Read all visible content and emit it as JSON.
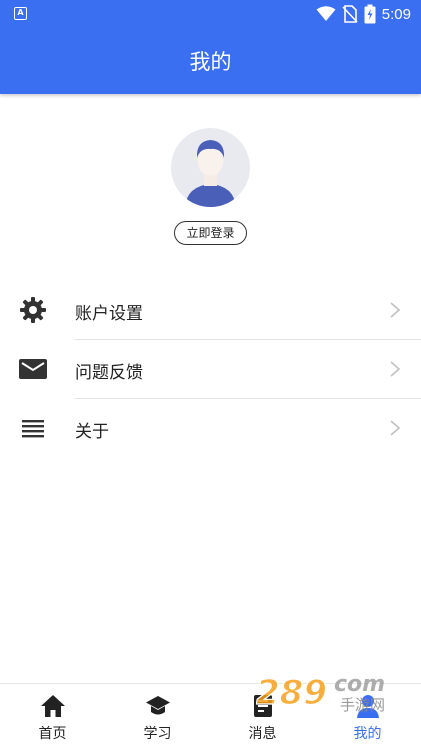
{
  "status_bar": {
    "time": "5:09",
    "app_icon": "A"
  },
  "header": {
    "title": "我的"
  },
  "profile": {
    "login_label": "立即登录"
  },
  "menu": [
    {
      "label": "账户设置",
      "icon": "gear-icon"
    },
    {
      "label": "问题反馈",
      "icon": "mail-icon"
    },
    {
      "label": "关于",
      "icon": "list-icon"
    }
  ],
  "tabs": [
    {
      "label": "首页",
      "icon": "home-icon",
      "active": false
    },
    {
      "label": "学习",
      "icon": "graduation-cap-icon",
      "active": false
    },
    {
      "label": "消息",
      "icon": "document-icon",
      "active": false
    },
    {
      "label": "我的",
      "icon": "user-icon",
      "active": true
    }
  ],
  "watermark": {
    "text": "289com 手游网"
  },
  "colors": {
    "primary": "#3a6ff2",
    "text": "#222222",
    "divider": "#e3e3e3",
    "icon": "#333333"
  }
}
